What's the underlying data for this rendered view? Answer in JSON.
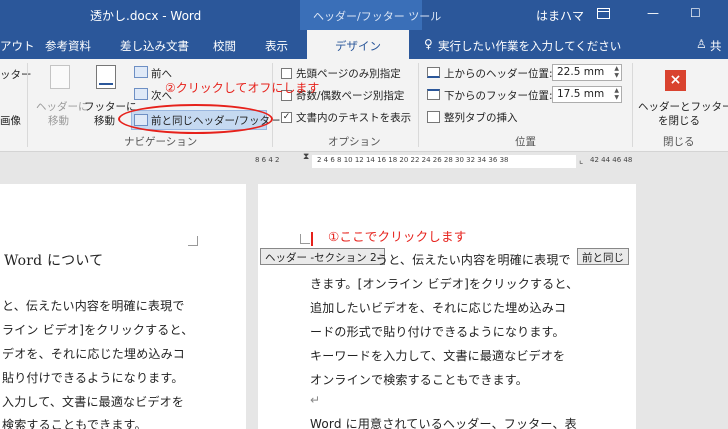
{
  "window": {
    "title": "透かし.docx - Word",
    "context_tool": "ヘッダー/フッター ツール",
    "user": "はまハマ",
    "restore_icon": "ribbon-display-icon",
    "minimize": "—",
    "maximize": "☐"
  },
  "tabs": {
    "file_partial": "アウト",
    "references": "参考資料",
    "mailings": "差し込み文書",
    "review": "校閲",
    "view": "表示",
    "design": "デザイン",
    "tell_me": "実行したい作業を入力してください",
    "share": "共"
  },
  "ribbon": {
    "left_partial_top": "ッター",
    "left_partial_bottom": "画像",
    "nav": {
      "goto_header": "ヘッダーに\n移動",
      "goto_header_l1": "ヘッダーに",
      "goto_header_l2": "移動",
      "goto_footer_l1": "フッターに",
      "goto_footer_l2": "移動",
      "prev": "前へ",
      "next": "次へ",
      "link_previous": "前と同じヘッダー/フッター",
      "group_label": "ナビゲーション"
    },
    "options": {
      "different_first": "先頭ページのみ別指定",
      "different_odd_even": "奇数/偶数ページ別指定",
      "show_doc_text": "文書内のテキストを表示",
      "group_label": "オプション"
    },
    "position": {
      "header_from_top_label": "上からのヘッダー位置:",
      "header_from_top_value": "22.5 mm",
      "footer_from_bottom_label": "下からのフッター位置:",
      "footer_from_bottom_value": "17.5 mm",
      "insert_align_tab": "整列タブの挿入",
      "group_label": "位置"
    },
    "close": {
      "label_l1": "ヘッダーとフッター",
      "label_l2": "を閉じる",
      "group_label": "閉じる"
    }
  },
  "annotations": {
    "step2": "②クリックしてオフにします",
    "step1": "①ここでクリックします"
  },
  "ruler": {
    "left_nums": "8  6  4  2",
    "mid_nums": "2  4  6  8  10 12 14 16 18 20 22 24 26 28 30 32 34 36 38",
    "right_nums": "42 44 46 48"
  },
  "left_page": {
    "heading": "Word について",
    "lines": [
      "と、伝えたい内容を明確に表現で",
      "ライン ビデオ]をクリックすると、",
      "デオを、それに応じた埋め込みコ",
      "貼り付けできるようになります。",
      "入力して、文書に最適なビデオを",
      "検索することもできます。"
    ]
  },
  "right_page": {
    "header_tag": "ヘッダー -セクション 2-",
    "same_as_previous": "前と同じ",
    "lines": [
      "うと、伝えたい内容を明確に表現で",
      "きます。[オンライン ビデオ]をクリックすると、",
      "追加したいビデオを、それに応じた埋め込みコ",
      "ードの形式で貼り付けできるようになります。",
      "キーワードを入力して、文書に最適なビデオを",
      "オンラインで検索することもできます。",
      "↵",
      "Word に用意されているヘッダー、フッター、表"
    ]
  },
  "colors": {
    "title_bar": "#2b579a",
    "annotation_red": "#e6211b",
    "close_button": "#d9432f"
  }
}
